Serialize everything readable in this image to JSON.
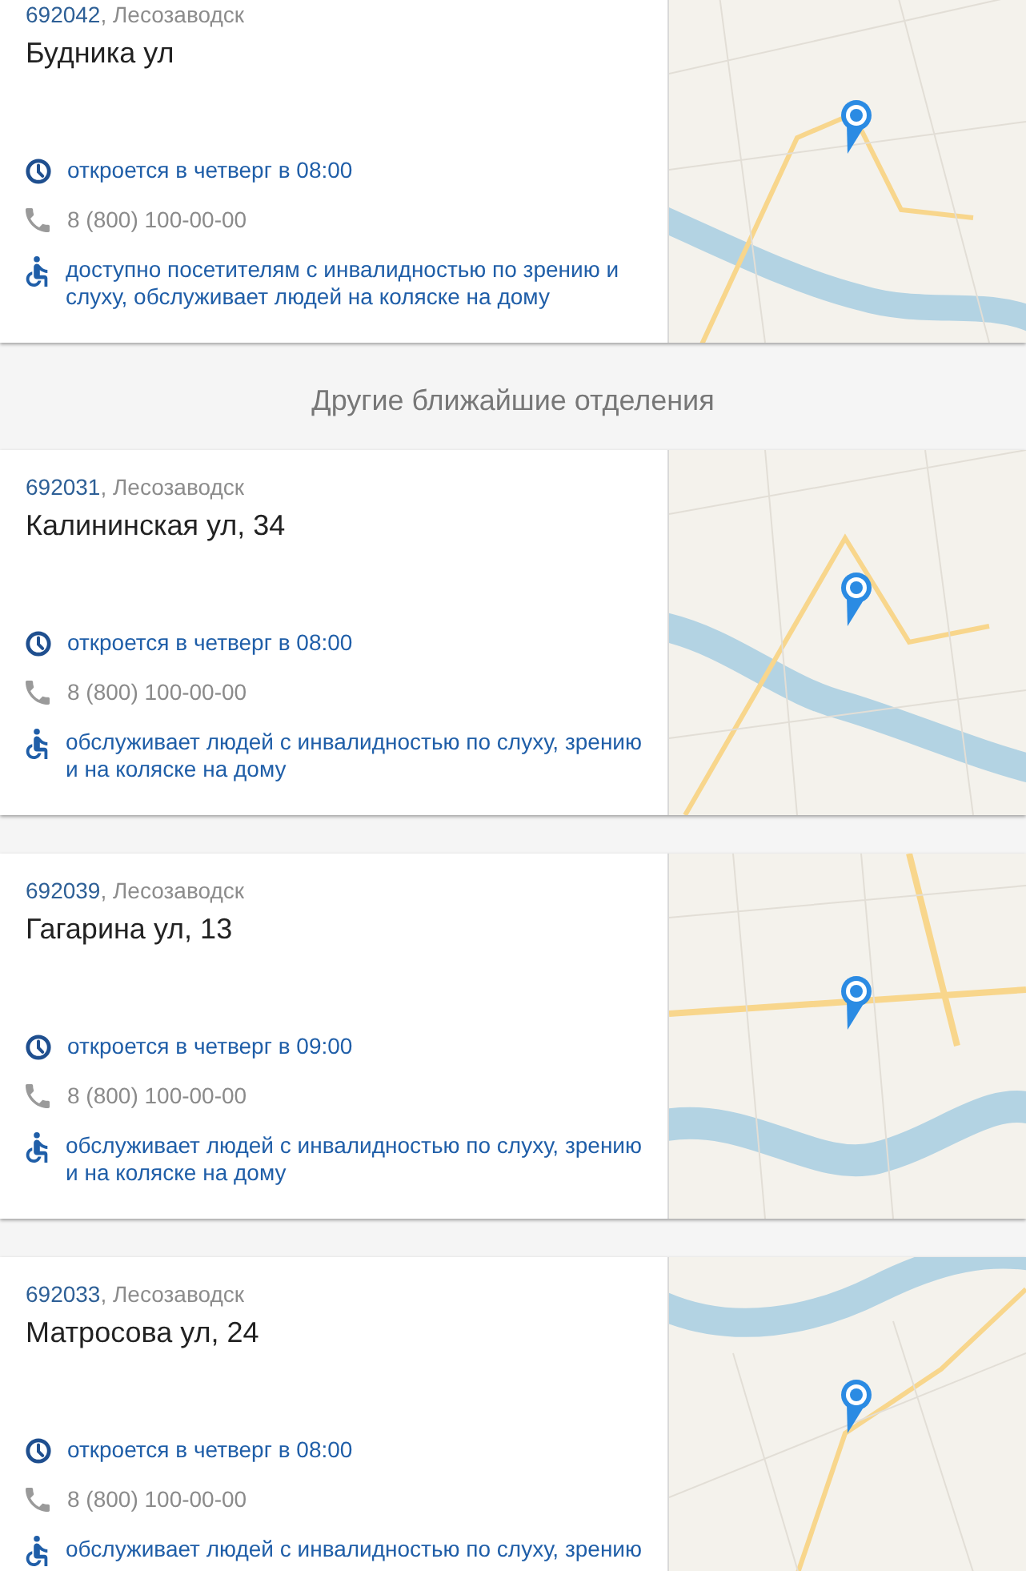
{
  "main_office": {
    "postcode": "692042",
    "locality": ", Лесозаводск",
    "address": "Будника ул",
    "hours": "откроется в четверг в 08:00",
    "phone": "8 (800) 100-00-00",
    "accessibility": "доступно посетителям с инвалидностью по зрению и слуху, обслуживает людей на коляске на дому"
  },
  "nearby_heading": "Другие ближайшие отделения",
  "nearby_offices": [
    {
      "postcode": "692031",
      "locality": ", Лесозаводск",
      "address": "Калининская ул, 34",
      "hours": "откроется в четверг в 08:00",
      "phone": "8 (800) 100-00-00",
      "accessibility": "обслуживает людей с инвалидностью по слуху, зрению и на коляске на дому"
    },
    {
      "postcode": "692039",
      "locality": ", Лесозаводск",
      "address": "Гагарина ул, 13",
      "hours": "откроется в четверг в 09:00",
      "phone": "8 (800) 100-00-00",
      "accessibility": "обслуживает людей с инвалидностью по слуху, зрению и на коляске на дому"
    },
    {
      "postcode": "692033",
      "locality": ", Лесозаводск",
      "address": "Матросова ул, 24",
      "hours": "откроется в четверг в 08:00",
      "phone": "8 (800) 100-00-00",
      "accessibility": "обслуживает людей с инвалидностью по слуху, зрению"
    }
  ]
}
